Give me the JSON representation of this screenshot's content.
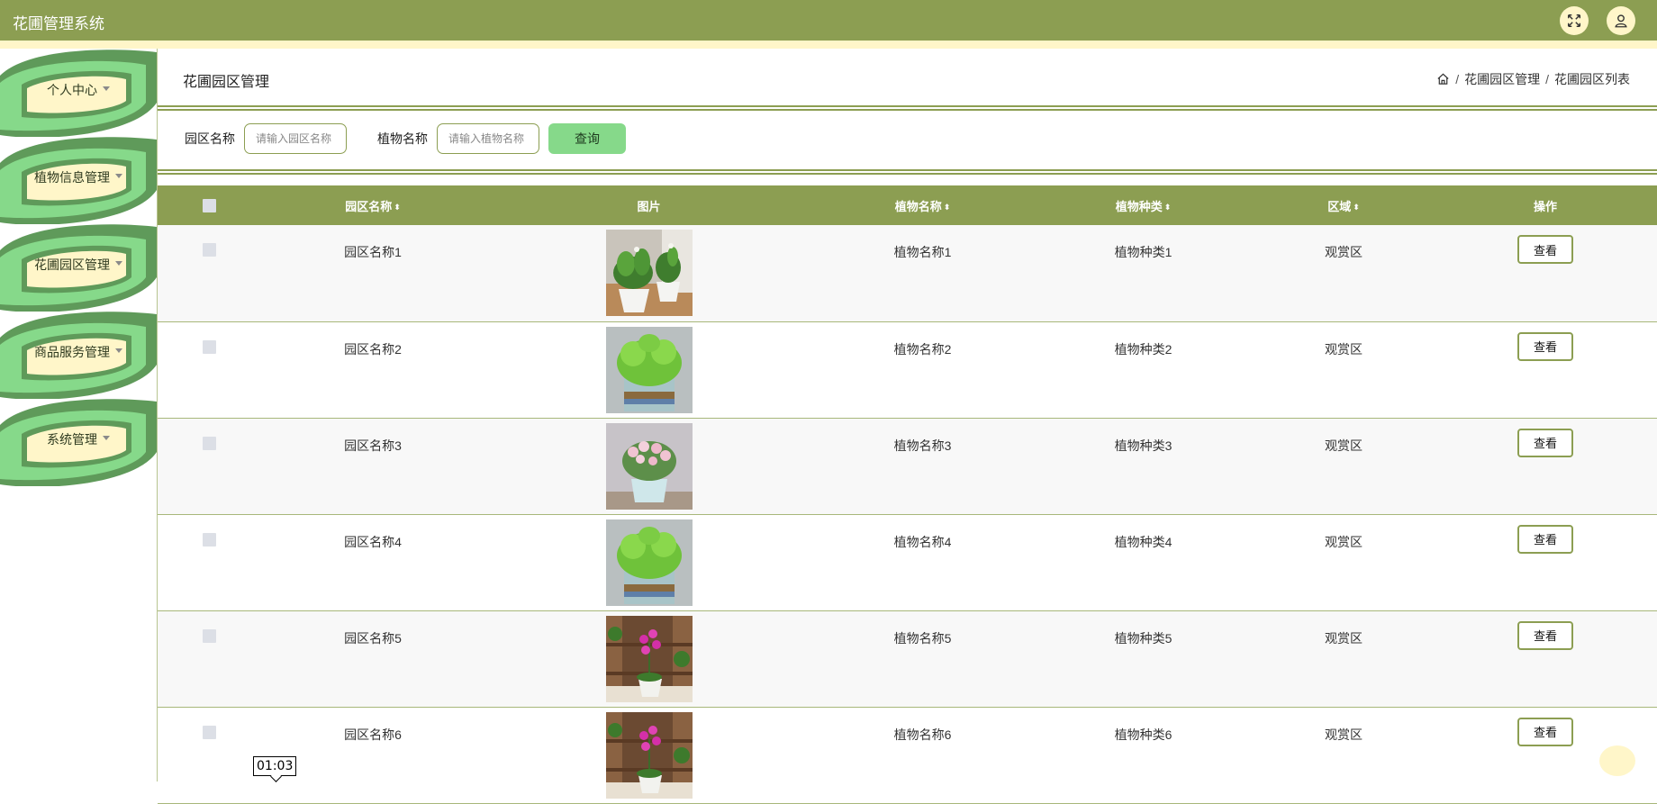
{
  "header": {
    "app_title": "花圃管理系统",
    "icons": [
      "fullscreen-icon",
      "user-icon"
    ]
  },
  "sidebar": {
    "items": [
      {
        "label": "个人中心"
      },
      {
        "label": "植物信息管理"
      },
      {
        "label": "花圃园区管理"
      },
      {
        "label": "商品服务管理"
      },
      {
        "label": "系统管理"
      }
    ]
  },
  "page": {
    "title": "花圃园区管理",
    "breadcrumb": [
      "花圃园区管理",
      "花圃园区列表"
    ]
  },
  "search": {
    "park_label": "园区名称",
    "park_placeholder": "请输入园区名称",
    "plant_label": "植物名称",
    "plant_placeholder": "请输入植物名称",
    "query_button": "查询"
  },
  "table": {
    "columns": [
      "园区名称",
      "图片",
      "植物名称",
      "植物种类",
      "区域",
      "操作"
    ],
    "rows": [
      {
        "park": "园区名称1",
        "plant": "植物名称1",
        "kind": "植物种类1",
        "area": "观赏区",
        "action": "查看",
        "image": "white-pot-green-plants"
      },
      {
        "park": "园区名称2",
        "plant": "植物名称2",
        "kind": "植物种类2",
        "area": "观赏区",
        "action": "查看",
        "image": "glass-pot-grass"
      },
      {
        "park": "园区名称3",
        "plant": "植物名称3",
        "kind": "植物种类3",
        "area": "观赏区",
        "action": "查看",
        "image": "pink-flowers-pot"
      },
      {
        "park": "园区名称4",
        "plant": "植物名称4",
        "kind": "植物种类4",
        "area": "观赏区",
        "action": "查看",
        "image": "glass-pot-grass"
      },
      {
        "park": "园区名称5",
        "plant": "植物名称5",
        "kind": "植物种类5",
        "area": "观赏区",
        "action": "查看",
        "image": "purple-orchid-shelf"
      },
      {
        "park": "园区名称6",
        "plant": "植物名称6",
        "kind": "植物种类6",
        "area": "观赏区",
        "action": "查看",
        "image": "purple-orchid-shelf"
      }
    ]
  },
  "timer": {
    "text": "01:03"
  },
  "colors": {
    "primary": "#8c9e52",
    "accent_light": "#fff6c9",
    "button_green": "#86d98a",
    "leaf_dark": "#5f9a5a",
    "leaf_light": "#86d98a"
  }
}
